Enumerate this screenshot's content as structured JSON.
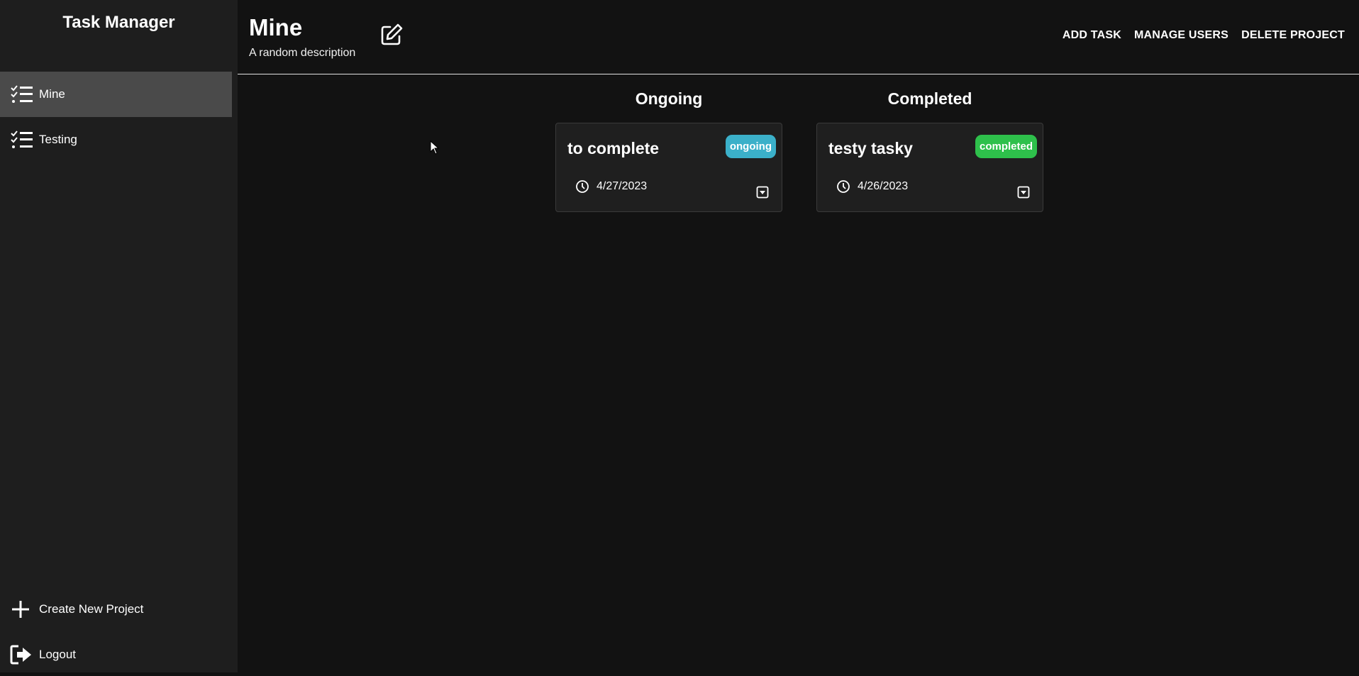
{
  "sidebar": {
    "title": "Task Manager",
    "items": [
      {
        "label": "Mine",
        "icon": "checklist-icon",
        "active": true
      },
      {
        "label": "Testing",
        "icon": "checklist-icon",
        "active": false
      }
    ],
    "create_label": "Create New Project",
    "logout_label": "Logout"
  },
  "header": {
    "title": "Mine",
    "description": "A random description",
    "actions": {
      "add_task": "ADD TASK",
      "manage_users": "MANAGE USERS",
      "delete_project": "DELETE PROJECT"
    }
  },
  "columns": [
    {
      "title": "Ongoing",
      "cards": [
        {
          "title": "to complete",
          "badge": "ongoing",
          "badge_color": "#3bb0c9",
          "date": "4/27/2023"
        }
      ]
    },
    {
      "title": "Completed",
      "cards": [
        {
          "title": "testy tasky",
          "badge": "completed",
          "badge_color": "#2ec04b",
          "date": "4/26/2023"
        }
      ]
    }
  ],
  "colors": {
    "background": "#121212",
    "sidebar": "#1e1e1e",
    "active_item": "#4a4a4a",
    "card": "#1f1f1f"
  }
}
